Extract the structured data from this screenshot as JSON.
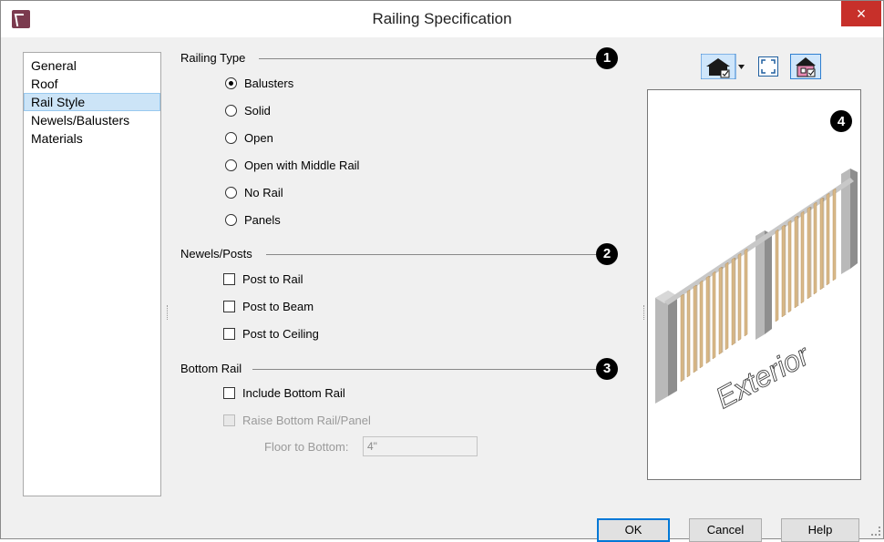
{
  "window": {
    "title": "Railing Specification",
    "close_glyph": "×"
  },
  "nav": {
    "items": [
      "General",
      "Roof",
      "Rail Style",
      "Newels/Balusters",
      "Materials"
    ],
    "selected_index": 2
  },
  "railing_type": {
    "label": "Railing Type",
    "badge": "1",
    "options": [
      "Balusters",
      "Solid",
      "Open",
      "Open with Middle Rail",
      "No Rail",
      "Panels"
    ],
    "selected": "Balusters"
  },
  "newels_posts": {
    "label": "Newels/Posts",
    "badge": "2",
    "options": [
      "Post to Rail",
      "Post to Beam",
      "Post to Ceiling"
    ]
  },
  "bottom_rail": {
    "label": "Bottom Rail",
    "badge": "3",
    "include_label": "Include Bottom Rail",
    "raise_label": "Raise Bottom Rail/Panel",
    "floor_label": "Floor to Bottom:",
    "floor_value": "4\""
  },
  "preview": {
    "badge": "4",
    "text": "Exterior"
  },
  "buttons": {
    "ok": "OK",
    "cancel": "Cancel",
    "help": "Help"
  },
  "colors": {
    "accent": "#0078d7",
    "close": "#c7302a",
    "selection": "#cce4f7",
    "baluster": "#d9b98a"
  }
}
